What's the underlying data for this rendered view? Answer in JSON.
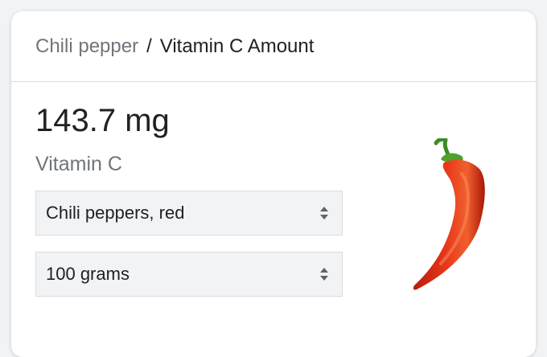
{
  "breadcrumb": {
    "parent": "Chili pepper",
    "separator": "/",
    "current": "Vitamin C Amount"
  },
  "result": {
    "amount": "143.7 mg",
    "nutrient": "Vitamin C"
  },
  "selects": {
    "food": {
      "value": "Chili peppers, red"
    },
    "quantity": {
      "value": "100 grams"
    }
  },
  "image": {
    "icon": "chili-pepper-image"
  },
  "colors": {
    "card_bg": "#ffffff",
    "select_bg": "#f1f3f4",
    "muted_text": "#70757a",
    "text": "#202124",
    "pepper_red": "#d62c12",
    "stem_green": "#3a8c24"
  }
}
